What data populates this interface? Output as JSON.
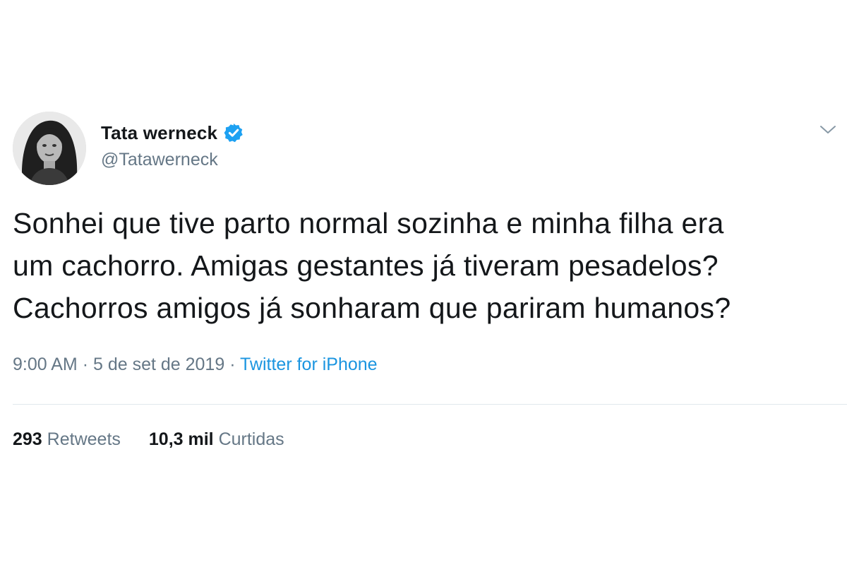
{
  "user": {
    "display_name": "Tata werneck",
    "handle": "@Tatawerneck",
    "verified": true,
    "avatar_icon": "profile-photo"
  },
  "tweet": {
    "lines": [
      "Sonhei que tive parto normal sozinha e minha filha era",
      "um cachorro. Amigas gestantes já tiveram pesadelos?",
      "Cachorros amigos já sonharam que pariram humanos?"
    ],
    "time": "9:00 AM",
    "separator": "·",
    "date": "5 de set de 2019",
    "source": "Twitter for iPhone"
  },
  "stats": {
    "retweets_count": "293",
    "retweets_label": "Retweets",
    "likes_count": "10,3 mil",
    "likes_label": "Curtidas"
  },
  "colors": {
    "text": "#14171a",
    "secondary": "#657786",
    "link": "#1b95e0",
    "verified": "#1da1f2",
    "divider": "#e1e8ed"
  },
  "icons": {
    "verified": "verified-badge-icon",
    "menu": "chevron-down-icon"
  }
}
